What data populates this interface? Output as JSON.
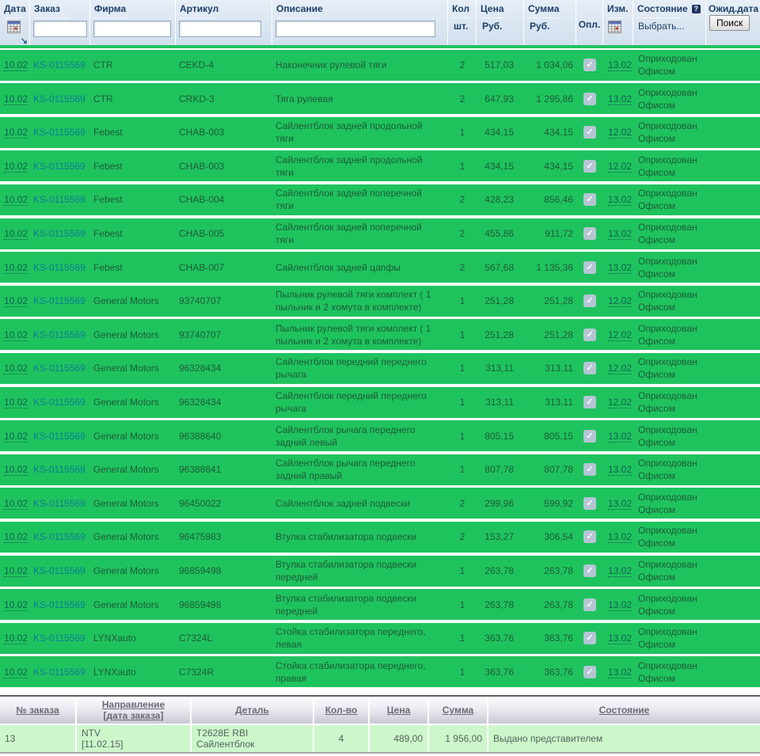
{
  "icons": {
    "check": "✓",
    "sort_arrow": "↘",
    "help": "?"
  },
  "colors": {
    "row_green": "#1fc35e",
    "header_bg": "#d2dfee",
    "order_link": "#0b7e95",
    "orders_row_green": "#cdf6cb"
  },
  "main_table": {
    "header": {
      "date": "Дата",
      "order": "Заказ",
      "firm": "Фирма",
      "article": "Артикул",
      "desc": "Описание",
      "qty": "Кол",
      "qty_unit": "шт.",
      "price": "Цена",
      "price_unit": "Руб.",
      "sum": "Сумма",
      "sum_unit": "Руб.",
      "paid": "Опл.",
      "izm": "Изм.",
      "status": "Состояние",
      "status_select": "Выбрать...",
      "wait_date": "Ожид.дата",
      "search_button": "Поиск"
    },
    "rows": [
      {
        "date": "10.02",
        "order": "KS-0115569",
        "firm": "CTR",
        "article": "CEKD-4",
        "desc": "Наконечник рулевой тяги",
        "qty": "2",
        "price": "517,03",
        "sum": "1 034,06",
        "paid": "✓",
        "izm": "13.02",
        "status": "Оприходован Офисом"
      },
      {
        "date": "10.02",
        "order": "KS-0115569",
        "firm": "CTR",
        "article": "CRKD-3",
        "desc": "Тяга рулевая",
        "qty": "2",
        "price": "647,93",
        "sum": "1 295,86",
        "paid": "✓",
        "izm": "13.02",
        "status": "Оприходован Офисом"
      },
      {
        "date": "10.02",
        "order": "KS-0115569",
        "firm": "Febest",
        "article": "CHAB-003",
        "desc": "Сайлентблок задней продольной тяги",
        "qty": "1",
        "price": "434,15",
        "sum": "434,15",
        "paid": "✓",
        "izm": "12.02",
        "status": "Оприходован Офисом"
      },
      {
        "date": "10.02",
        "order": "KS-0115569",
        "firm": "Febest",
        "article": "CHAB-003",
        "desc": "Сайлентблок задней продольной тяги",
        "qty": "1",
        "price": "434,15",
        "sum": "434,15",
        "paid": "✓",
        "izm": "12.02",
        "status": "Оприходован Офисом"
      },
      {
        "date": "10.02",
        "order": "KS-0115569",
        "firm": "Febest",
        "article": "CHAB-004",
        "desc": "Сайлентблок задней поперечной тяги",
        "qty": "2",
        "price": "428,23",
        "sum": "856,46",
        "paid": "✓",
        "izm": "13.02",
        "status": "Оприходован Офисом"
      },
      {
        "date": "10.02",
        "order": "KS-0115569",
        "firm": "Febest",
        "article": "CHAB-005",
        "desc": "Сайлентблок задней поперечной тяги",
        "qty": "2",
        "price": "455,86",
        "sum": "911,72",
        "paid": "✓",
        "izm": "13.02",
        "status": "Оприходован Офисом"
      },
      {
        "date": "10.02",
        "order": "KS-0115569",
        "firm": "Febest",
        "article": "CHAB-007",
        "desc": "Сайлентблок задней цапфы",
        "qty": "2",
        "price": "567,68",
        "sum": "1 135,36",
        "paid": "✓",
        "izm": "13.02",
        "status": "Оприходован Офисом"
      },
      {
        "date": "10.02",
        "order": "KS-0115569",
        "firm": "General Motors",
        "article": "93740707",
        "desc": "Пыльник рулевой тяги комплект ( 1 пыльник и 2 хомута в комплекте)",
        "qty": "1",
        "price": "251,28",
        "sum": "251,28",
        "paid": "✓",
        "izm": "12.02",
        "status": "Оприходован Офисом"
      },
      {
        "date": "10.02",
        "order": "KS-0115569",
        "firm": "General Motors",
        "article": "93740707",
        "desc": "Пыльник рулевой тяги комплект ( 1 пыльник и 2 хомута в комплекте)",
        "qty": "1",
        "price": "251,28",
        "sum": "251,28",
        "paid": "✓",
        "izm": "12.02",
        "status": "Оприходован Офисом"
      },
      {
        "date": "10.02",
        "order": "KS-0115569",
        "firm": "General Motors",
        "article": "96328434",
        "desc": "Сайлентблок передний переднего рычага",
        "qty": "1",
        "price": "313,11",
        "sum": "313,11",
        "paid": "✓",
        "izm": "12.02",
        "status": "Оприходован Офисом"
      },
      {
        "date": "10.02",
        "order": "KS-0115569",
        "firm": "General Motors",
        "article": "96328434",
        "desc": "Сайлентблок передний переднего рычага",
        "qty": "1",
        "price": "313,11",
        "sum": "313,11",
        "paid": "✓",
        "izm": "12.02",
        "status": "Оприходован Офисом"
      },
      {
        "date": "10.02",
        "order": "KS-0115569",
        "firm": "General Motors",
        "article": "96388640",
        "desc": "Сайлентблок рычага переднего задний левый",
        "qty": "1",
        "price": "805,15",
        "sum": "805,15",
        "paid": "✓",
        "izm": "13.02",
        "status": "Оприходован Офисом"
      },
      {
        "date": "10.02",
        "order": "KS-0115569",
        "firm": "General Motors",
        "article": "96388641",
        "desc": "Сайлентблок рычага переднего задний правый",
        "qty": "1",
        "price": "807,78",
        "sum": "807,78",
        "paid": "✓",
        "izm": "13.02",
        "status": "Оприходован Офисом"
      },
      {
        "date": "10.02",
        "order": "KS-0115569",
        "firm": "General Motors",
        "article": "96450022",
        "desc": "Сайлентблок задней подвески",
        "qty": "2",
        "price": "299,96",
        "sum": "599,92",
        "paid": "✓",
        "izm": "13.02",
        "status": "Оприходован Офисом"
      },
      {
        "date": "10.02",
        "order": "KS-0115569",
        "firm": "General Motors",
        "article": "96475983",
        "desc": "Втулка стабилизатора подвески",
        "qty": "2",
        "price": "153,27",
        "sum": "306,54",
        "paid": "✓",
        "izm": "13.02",
        "status": "Оприходован Офисом"
      },
      {
        "date": "10.02",
        "order": "KS-0115569",
        "firm": "General Motors",
        "article": "96859498",
        "desc": "Втулка стабилизатора подвески передней",
        "qty": "1",
        "price": "263,78",
        "sum": "263,78",
        "paid": "✓",
        "izm": "13.02",
        "status": "Оприходован Офисом"
      },
      {
        "date": "10.02",
        "order": "KS-0115569",
        "firm": "General Motors",
        "article": "96859498",
        "desc": "Втулка стабилизатора подвески передней",
        "qty": "1",
        "price": "263,78",
        "sum": "263,78",
        "paid": "✓",
        "izm": "13.02",
        "status": "Оприходован Офисом"
      },
      {
        "date": "10.02",
        "order": "KS-0115569",
        "firm": "LYNXauto",
        "article": "C7324L",
        "desc": "Стойка стабилизатора переднего, левая",
        "qty": "1",
        "price": "363,76",
        "sum": "363,76",
        "paid": "✓",
        "izm": "13.02",
        "status": "Оприходован Офисом"
      },
      {
        "date": "10.02",
        "order": "KS-0115569",
        "firm": "LYNXauto",
        "article": "C7324R",
        "desc": "Стойка стабилизатора переднего, правая",
        "qty": "1",
        "price": "363,76",
        "sum": "363,76",
        "paid": "✓",
        "izm": "13.02",
        "status": "Оприходован Офисом"
      }
    ]
  },
  "orders_table": {
    "header": {
      "order_no": "№ заказа",
      "direction_l1": "Направление",
      "direction_l2": "[дата заказа]",
      "part": "Деталь",
      "qty": "Кол-во",
      "price": "Цена",
      "sum": "Сумма",
      "status": "Состояние"
    },
    "rows": [
      {
        "order_no": "13",
        "direction_l1": "NTV",
        "direction_l2": "[11.02.15]",
        "part_l1": "T2628E RBI",
        "part_l2": "Сайлентблок",
        "qty": "4",
        "price": "489,00",
        "sum": "1 956,00",
        "status": "Выдано представителем"
      }
    ]
  }
}
